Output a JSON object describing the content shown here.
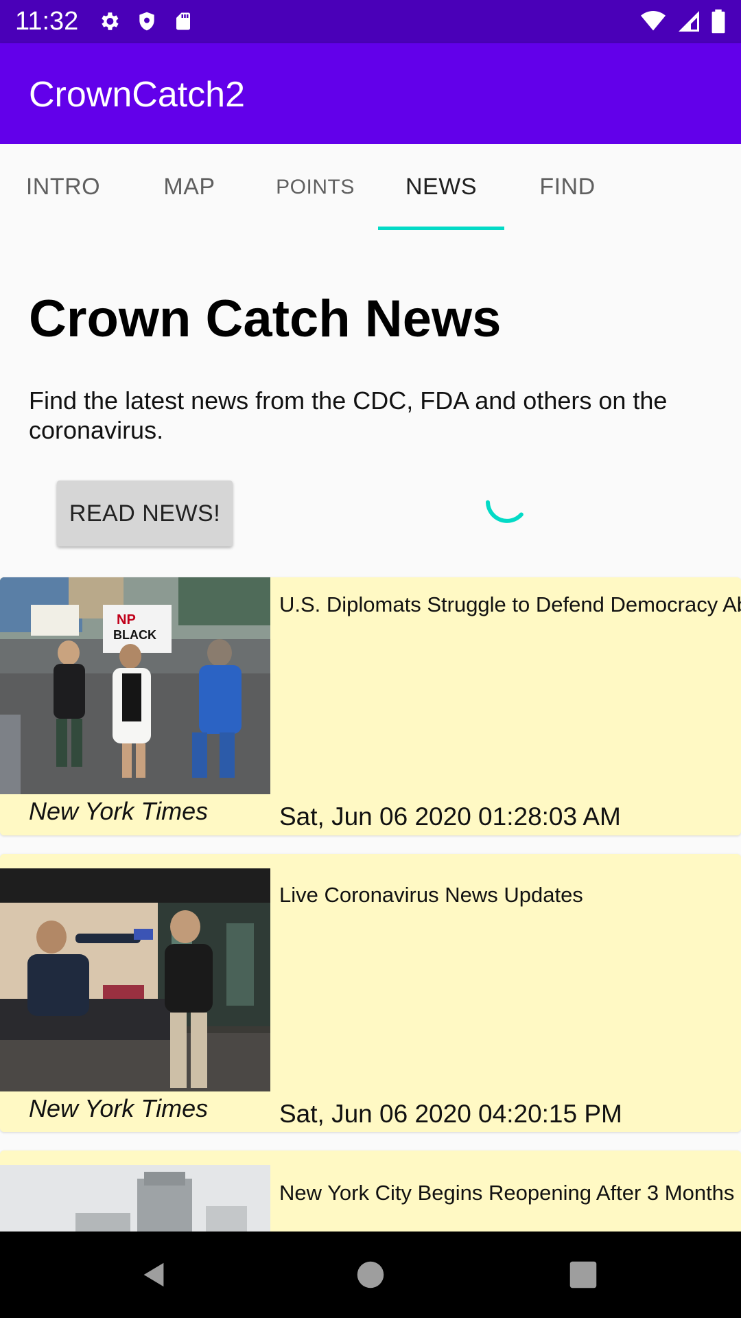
{
  "status_bar": {
    "time": "11:32",
    "left_icons": [
      "settings-icon",
      "shield-icon",
      "sd-card-icon"
    ],
    "right_icons": [
      "wifi-icon",
      "cell-signal-icon",
      "battery-icon"
    ]
  },
  "app_bar": {
    "title": "CrownCatch2",
    "color": "#6200ea"
  },
  "tabs": [
    {
      "label": "INTRO",
      "active": false
    },
    {
      "label": "MAP",
      "active": false
    },
    {
      "label": "POINTS",
      "active": false
    },
    {
      "label": "NEWS",
      "active": true
    },
    {
      "label": "FIND",
      "active": false
    }
  ],
  "accent_color": "#03dac6",
  "main": {
    "heading": "Crown Catch News",
    "description": "Find the latest news from the CDC, FDA and others on the coronavirus.",
    "read_button": "READ NEWS!"
  },
  "news": [
    {
      "title": "U.S. Diplomats Struggle to Defend Democracy Abroad",
      "source": "New York Times",
      "date": "Sat, Jun 06 2020 01:28:03 AM",
      "image": "protest-photo"
    },
    {
      "title": "Live Coronavirus News Updates",
      "source": "New York Times",
      "date": "Sat, Jun 06 2020 04:20:15 PM",
      "image": "temperature-check-photo"
    },
    {
      "title": "New York City Begins Reopening After 3 Months",
      "source": "",
      "date": "",
      "image": "city-buildings-photo"
    }
  ],
  "card_color": "#fff9c4",
  "nav_bar": {
    "buttons": [
      "back-icon",
      "home-icon",
      "recents-icon"
    ]
  }
}
